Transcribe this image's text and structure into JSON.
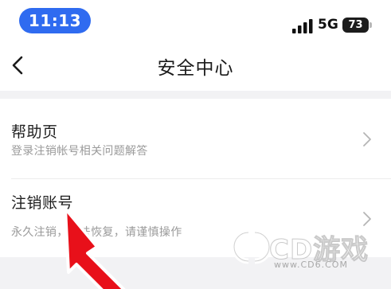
{
  "status_bar": {
    "time": "11:13",
    "network": "5G",
    "battery_level": "73",
    "colors": {
      "time_pill": "#2f6bf0"
    }
  },
  "nav": {
    "back_icon": "chevron-left-icon",
    "title": "安全中心"
  },
  "items": [
    {
      "title": "帮助页",
      "subtitle": "登录注销帐号相关问题解答",
      "icon": "chevron-right-icon"
    },
    {
      "title": "注销账号",
      "subtitle": "永久注销，无法恢复，请谨慎操作",
      "icon": "chevron-right-icon"
    }
  ],
  "annotation": {
    "arrow_color": "#e8101a"
  },
  "watermark": {
    "text": "CD游戏",
    "sub": "www.CD6.COM"
  }
}
